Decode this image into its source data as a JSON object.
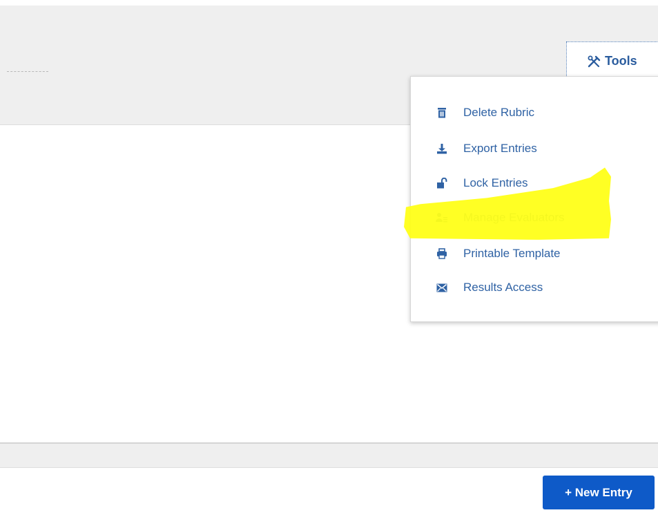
{
  "tools_tab": {
    "label": "Tools",
    "icon": "tools-icon"
  },
  "menu": {
    "items": [
      {
        "label": "Delete Rubric",
        "icon": "trash-icon"
      },
      {
        "label": "Export Entries",
        "icon": "download-icon"
      },
      {
        "label": "Lock Entries",
        "icon": "unlock-icon"
      },
      {
        "label": "Manage Evaluators",
        "icon": "user-list-icon",
        "highlighted": true
      },
      {
        "label": "Printable Template",
        "icon": "printer-icon"
      },
      {
        "label": "Results Access",
        "icon": "envelope-icon"
      }
    ]
  },
  "footer": {
    "new_entry_label": "+ New Entry"
  },
  "colors": {
    "accent": "#2f62a4",
    "button": "#0e5ac8",
    "highlight": "#ffff18",
    "panel_bg": "#efefef"
  }
}
